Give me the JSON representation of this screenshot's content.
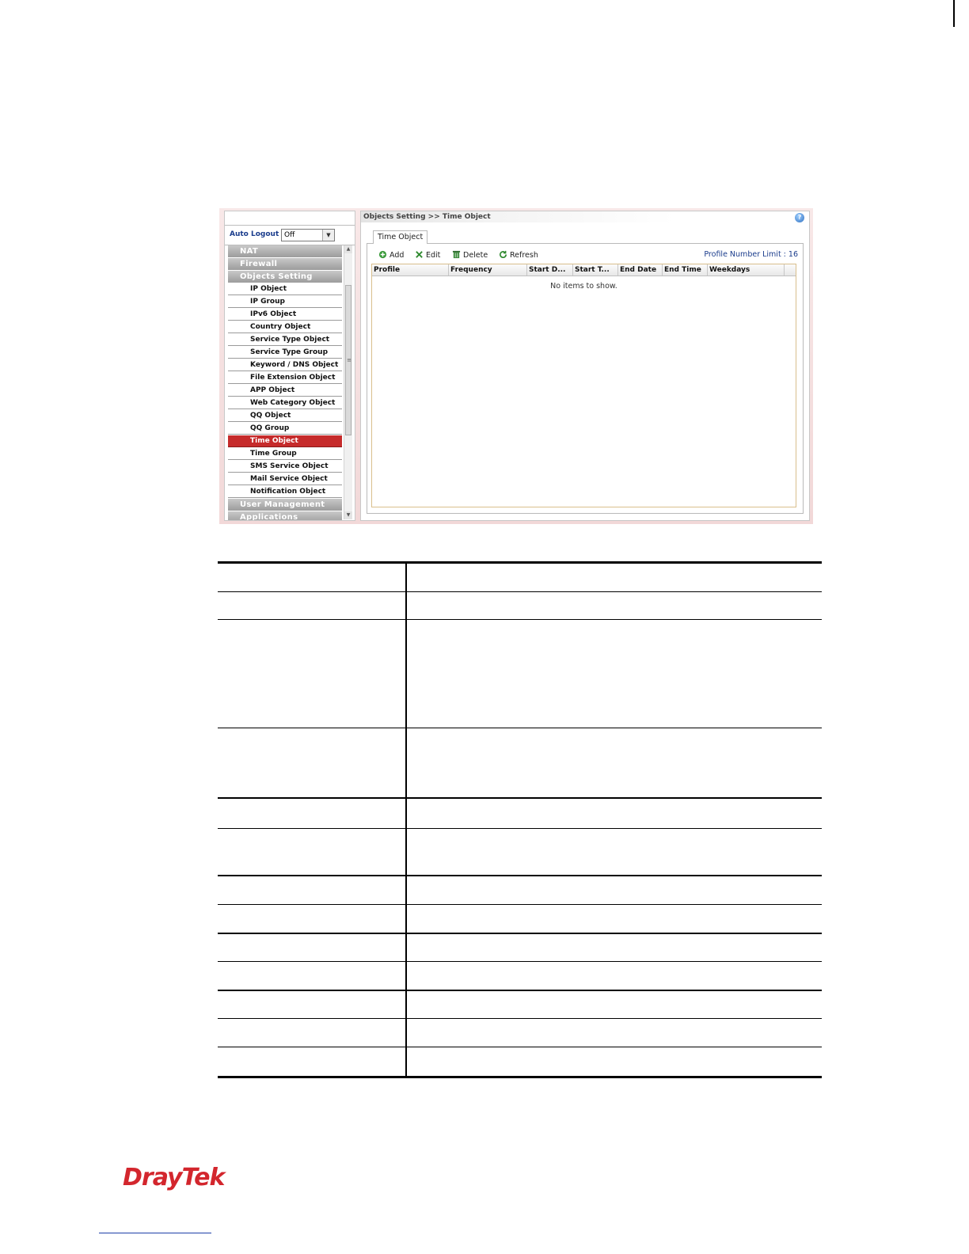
{
  "breadcrumb": "Objects Setting >> Time Object",
  "auto_logout": {
    "label": "Auto Logout :",
    "value": "Off"
  },
  "menu": [
    {
      "type": "category",
      "label": "NAT"
    },
    {
      "type": "category",
      "label": "Firewall"
    },
    {
      "type": "category",
      "label": "Objects Setting"
    },
    {
      "type": "item",
      "label": "IP Object"
    },
    {
      "type": "item",
      "label": "IP Group"
    },
    {
      "type": "item",
      "label": "IPv6 Object"
    },
    {
      "type": "item",
      "label": "Country Object"
    },
    {
      "type": "item",
      "label": "Service Type Object"
    },
    {
      "type": "item",
      "label": "Service Type Group"
    },
    {
      "type": "item",
      "label": "Keyword / DNS Object"
    },
    {
      "type": "item",
      "label": "File Extension Object"
    },
    {
      "type": "item",
      "label": "APP Object"
    },
    {
      "type": "item",
      "label": "Web Category Object"
    },
    {
      "type": "item",
      "label": "QQ Object"
    },
    {
      "type": "item",
      "label": "QQ Group"
    },
    {
      "type": "item",
      "label": "Time Object",
      "active": true
    },
    {
      "type": "item",
      "label": "Time Group"
    },
    {
      "type": "item",
      "label": "SMS Service Object"
    },
    {
      "type": "item",
      "label": "Mail Service Object"
    },
    {
      "type": "item",
      "label": "Notification Object"
    },
    {
      "type": "category",
      "label": "User Management"
    },
    {
      "type": "category",
      "label": "Applications"
    }
  ],
  "tab_label": "Time Object",
  "toolbar": {
    "add": "Add",
    "edit": "Edit",
    "delete": "Delete",
    "refresh": "Refresh",
    "profile_limit": "Profile Number Limit : 16"
  },
  "grid": {
    "columns": [
      "Profile",
      "Frequency",
      "Start D...",
      "Start T...",
      "End Date",
      "End Time",
      "Weekdays"
    ],
    "empty_text": "No items to show."
  },
  "colors": {
    "active_menu": "#c62b2b",
    "brand": "#d3262d",
    "link_blue": "#1a3c8c"
  },
  "footer": {
    "logo_text": "DrayTek"
  }
}
